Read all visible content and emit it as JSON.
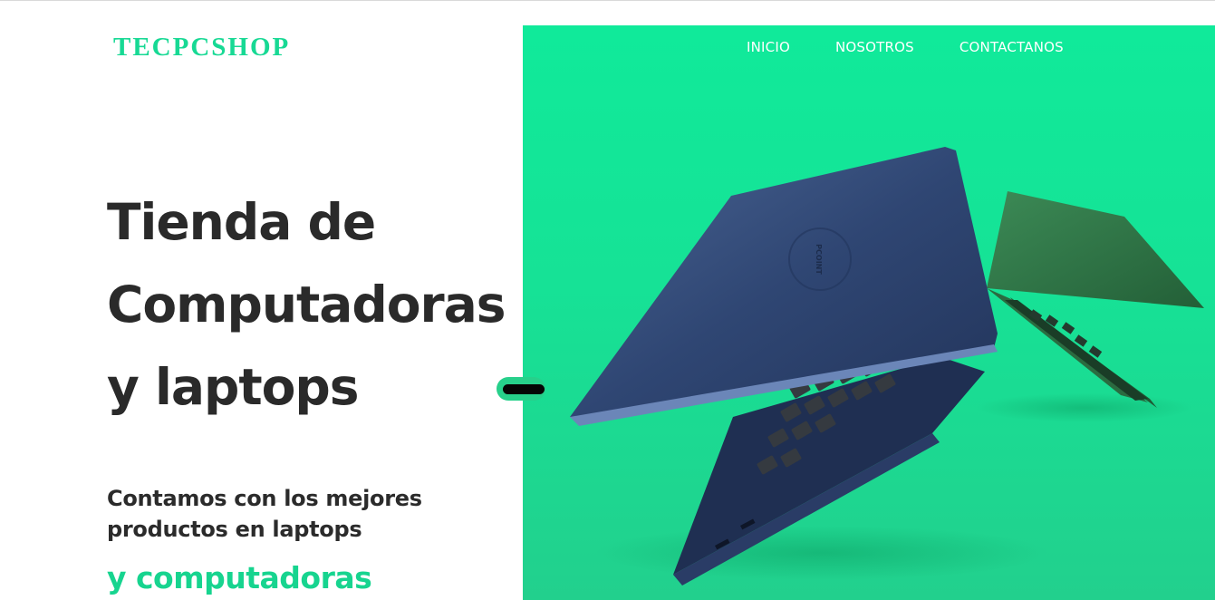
{
  "brand": {
    "logo_text": "TECPCSHOP"
  },
  "nav": {
    "items": [
      "INICIO",
      "NOSOTROS",
      "CONTACTANOS"
    ]
  },
  "hero": {
    "title_lines": [
      "Tienda de",
      "Computadoras",
      "y laptops"
    ],
    "subtitle_lines": [
      "Contamos con los mejores",
      "productos en laptops"
    ],
    "accent_text": "y computadoras",
    "laptop_lid_text": "PCOINT"
  },
  "colors": {
    "accent": "#17d994",
    "panel_green": "#10ea9a",
    "dark_text": "#2a2a2a",
    "laptop_blue": "#2e4470",
    "laptop_green": "#2f7a46"
  }
}
